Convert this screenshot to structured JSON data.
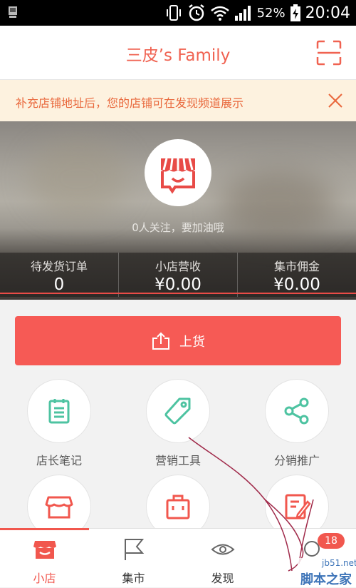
{
  "status_bar": {
    "battery": "52%",
    "time": "20:04"
  },
  "header": {
    "title": "三皮’s Family"
  },
  "notice": {
    "text": "补充店铺地址后，您的店铺可在发现频道展示"
  },
  "shop": {
    "followers_text": "0人关注，要加油哦"
  },
  "stats": [
    {
      "label": "待发货订单",
      "value": "0"
    },
    {
      "label": "小店营收",
      "value": "¥0.00"
    },
    {
      "label": "集市佣金",
      "value": "¥0.00"
    }
  ],
  "upload_button": {
    "label": "上货"
  },
  "tools": [
    {
      "name": "店长笔记",
      "icon": "notepad-icon"
    },
    {
      "name": "营销工具",
      "icon": "tag-icon"
    },
    {
      "name": "分销推广",
      "icon": "share-icon"
    },
    {
      "name": "",
      "icon": "shop-icon"
    },
    {
      "name": "",
      "icon": "bag-icon"
    },
    {
      "name": "",
      "icon": "edit-doc-icon"
    }
  ],
  "tabs": [
    {
      "label": "小店",
      "icon": "shop-icon",
      "active": true
    },
    {
      "label": "集市",
      "icon": "flag-icon",
      "active": false
    },
    {
      "label": "发现",
      "icon": "eye-icon",
      "active": false
    }
  ],
  "badge": {
    "count": "18"
  },
  "watermark": {
    "site": "jb51.net",
    "brand": "脚本之家"
  },
  "colors": {
    "accent": "#f1574e",
    "teal": "#4dc3a1",
    "notice_bg": "#fdf2df",
    "notice_text": "#e9683c"
  }
}
